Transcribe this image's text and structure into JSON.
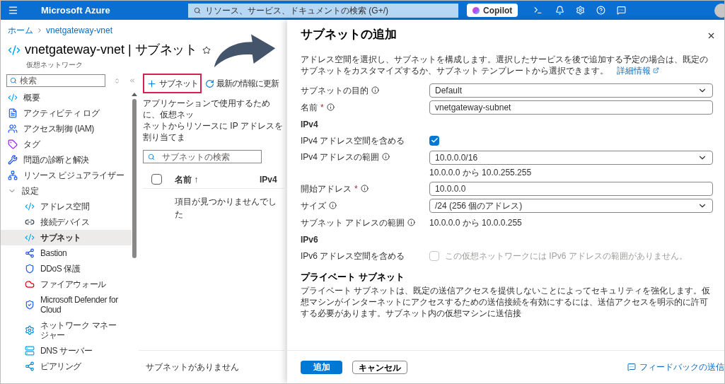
{
  "topbar": {
    "brand": "Microsoft Azure",
    "search_placeholder": "リソース、サービス、ドキュメントの検索 (G+/)",
    "copilot": "Copilot"
  },
  "breadcrumb": [
    "ホーム",
    "vnetgateway-vnet"
  ],
  "page": {
    "title": "vnetgateway-vnet",
    "separator": "|",
    "section": "サブネット",
    "subtitle": "仮想ネットワーク",
    "favorite": false
  },
  "sidebar": {
    "search_placeholder": "検索",
    "items": [
      {
        "label": "概要",
        "selected": false
      },
      {
        "label": "アクティビティ ログ",
        "selected": false
      },
      {
        "label": "アクセス制御 (IAM)",
        "selected": false
      },
      {
        "label": "タグ",
        "selected": false
      },
      {
        "label": "問題の診断と解決",
        "selected": false
      },
      {
        "label": "リソース ビジュアライザー",
        "selected": false
      },
      {
        "label": "設定",
        "selected": false,
        "expanded": true,
        "children": [
          {
            "label": "アドレス空間",
            "selected": false
          },
          {
            "label": "接続デバイス",
            "selected": false
          },
          {
            "label": "サブネット",
            "selected": true
          },
          {
            "label": "Bastion",
            "selected": false
          },
          {
            "label": "DDoS 保護",
            "selected": false
          },
          {
            "label": "ファイアウォール",
            "selected": false
          },
          {
            "label": "Microsoft Defender for Cloud",
            "selected": false
          },
          {
            "label": "ネットワーク マネージャー",
            "selected": false
          },
          {
            "label": "DNS サーバー",
            "selected": false
          },
          {
            "label": "ピアリング",
            "selected": false
          }
        ]
      }
    ]
  },
  "toolbar": [
    {
      "label": "サブネット",
      "kind": "add",
      "highlighted": true
    },
    {
      "label": "最新の情報に更新",
      "kind": "refresh",
      "highlighted": false
    }
  ],
  "description_lines": [
    "アプリケーションで使用するために、仮想ネッ",
    "ネットからリソースに IP アドレスを割り当てま"
  ],
  "table": {
    "search_placeholder": "サブネットの検索",
    "select_all_checked": false,
    "columns": [
      "名前 ↑",
      "IPv4"
    ],
    "empty": "項目が見つかりませんでした",
    "footer": "サブネットがありません"
  },
  "panel": {
    "title": "サブネットの追加",
    "description": "アドレス空間を選択し、サブネットを構成します。選択したサービスを後で追加する予定の場合は、既定のサブネットをカスタマイズするか、サブネット テンプレートから選択できます。",
    "link": "詳細情報",
    "fields": [
      {
        "kind": "select",
        "label": "サブネットの目的",
        "info": true,
        "value": "Default"
      },
      {
        "kind": "text",
        "label": "名前",
        "required_mark": "*",
        "info": true,
        "value": "vnetgateway-subnet"
      },
      {
        "kind": "heading",
        "label": "IPv4"
      },
      {
        "kind": "checkbox",
        "label": "IPv4 アドレス空間を含める",
        "checked": true,
        "disabled": false
      },
      {
        "kind": "select",
        "label": "IPv4 アドレスの範囲",
        "info": true,
        "value": "10.0.0.0/16",
        "hint": "10.0.0.0 から 10.0.255.255"
      },
      {
        "kind": "text",
        "label": "開始アドレス",
        "required_mark": "*",
        "info": true,
        "value": "10.0.0.0"
      },
      {
        "kind": "select",
        "label": "サイズ",
        "info": true,
        "value": "/24 (256 個のアドレス)"
      },
      {
        "kind": "readonly",
        "label": "サブネット アドレスの範囲",
        "info": true,
        "value": "10.0.0.0 から 10.0.0.255"
      },
      {
        "kind": "heading",
        "label": "IPv6"
      },
      {
        "kind": "checkbox",
        "label": "IPv6 アドレス空間を含める",
        "checked": false,
        "disabled": true,
        "note": "この仮想ネットワークには IPv6 アドレスの範囲がありません。"
      }
    ],
    "private_heading": "プライベート サブネット",
    "private_text": "プライベート サブネットは、既定の送信アクセスを提供しないことによってセキュリティを強化します。仮想マシンがインターネットにアクセスするための送信接続を有効にするには、送信アクセスを明示的に許可する必要があります。サブネット内の仮想マシンに送信接",
    "buttons": [
      {
        "label": "追加",
        "kind": "primary"
      },
      {
        "label": "キャンセル",
        "kind": "secondary"
      }
    ],
    "feedback": "フィードバックの送信"
  }
}
